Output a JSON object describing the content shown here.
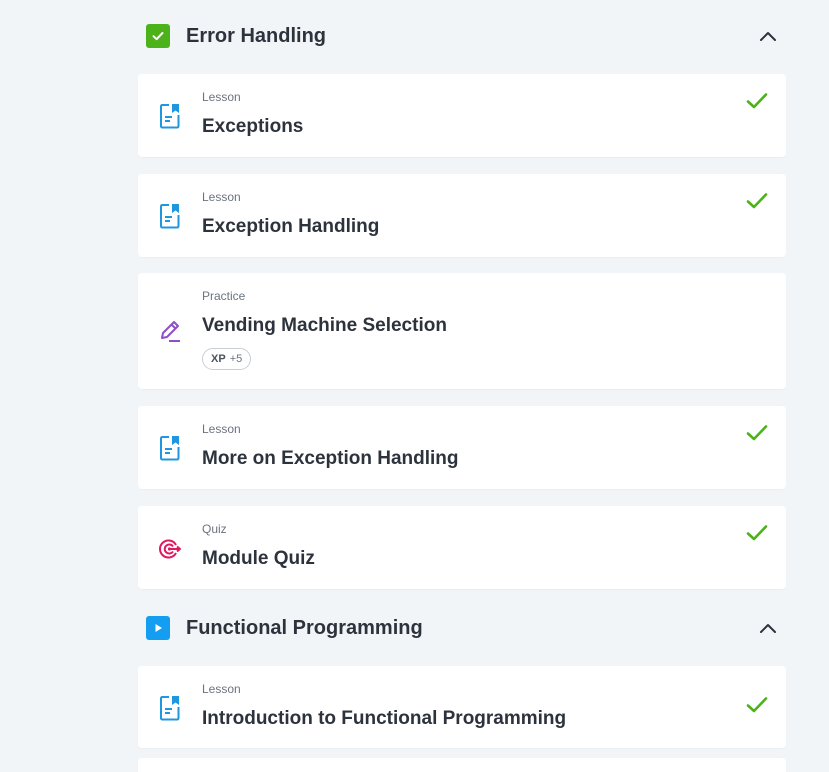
{
  "colors": {
    "background": "#f2f5f8",
    "done_green": "#4bb319",
    "lesson_blue": "#1f96e0",
    "practice_purple": "#8e4fc7",
    "quiz_pink": "#e0185e",
    "section_done": "#4bb319",
    "section_current": "#149ef2"
  },
  "sections": [
    {
      "title": "Error Handling",
      "status_icon": "check-square-icon",
      "expanded": true,
      "items": [
        {
          "type": "Lesson",
          "title": "Exceptions",
          "icon": "lesson-document-icon",
          "completed": true
        },
        {
          "type": "Lesson",
          "title": "Exception Handling",
          "icon": "lesson-document-icon",
          "completed": true
        },
        {
          "type": "Practice",
          "title": "Vending Machine Selection",
          "icon": "pencil-edit-icon",
          "completed": false,
          "xp_label": "XP",
          "xp_value": "+5"
        },
        {
          "type": "Lesson",
          "title": "More on Exception Handling",
          "icon": "lesson-document-icon",
          "completed": true
        },
        {
          "type": "Quiz",
          "title": "Module Quiz",
          "icon": "target-icon",
          "completed": true
        }
      ]
    },
    {
      "title": "Functional Programming",
      "status_icon": "play-square-icon",
      "expanded": true,
      "items": [
        {
          "type": "Lesson",
          "title": "Introduction to Functional Programming",
          "icon": "lesson-document-icon",
          "completed": true
        }
      ]
    }
  ]
}
